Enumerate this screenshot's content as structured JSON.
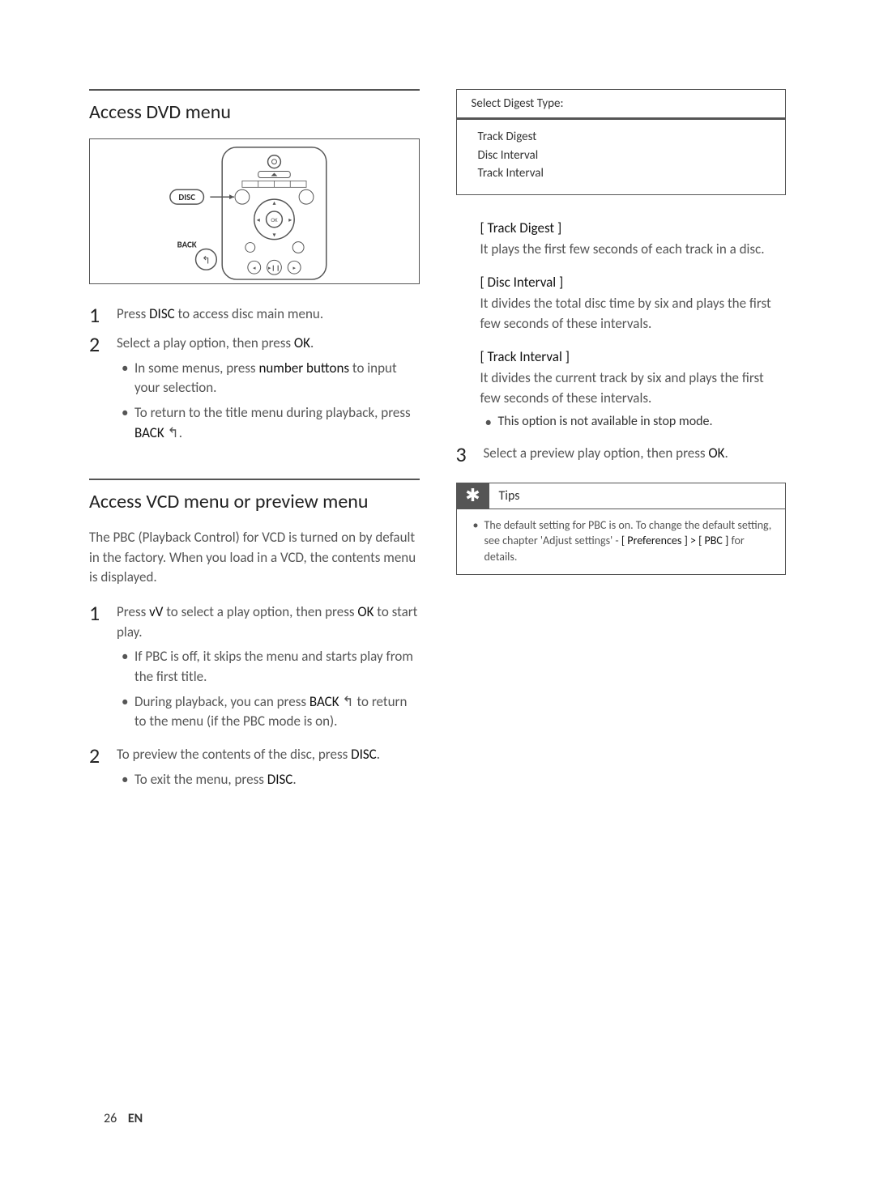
{
  "left": {
    "dvd": {
      "title": "Access DVD menu",
      "remote_labels": {
        "disc": "DISC",
        "back": "BACK",
        "ok": "OK"
      },
      "steps": [
        {
          "num": "1",
          "text_pre": "Press ",
          "bold1": "DISC",
          "text_post": " to access disc main menu."
        },
        {
          "num": "2",
          "text_pre": "Select a play option, then press ",
          "bold1": "OK",
          "text_post": ".",
          "subs": [
            {
              "pre": "In some menus, press ",
              "b": "number buttons",
              "post": " to input your selection."
            },
            {
              "pre": "To return to the title menu during playback, press ",
              "b": "BACK",
              "post": " ",
              "glyph": "↰",
              "tail": "."
            }
          ]
        }
      ]
    },
    "vcd": {
      "title": "Access VCD menu or preview menu",
      "intro": "The PBC (Playback Control) for VCD is turned on by default in the factory.  When you load in a VCD, the contents menu is displayed.",
      "steps": [
        {
          "num": "1",
          "text_pre": "Press ",
          "bold1": "vV",
          "mid": "  to select a play option, then press ",
          "bold2": "OK",
          "text_post": " to start play.",
          "subs": [
            {
              "pre": "If PBC is off, it skips the menu and starts play from the first title."
            },
            {
              "pre": "During playback, you can press ",
              "b": "BACK",
              "post": " ",
              "glyph": "↰",
              "tail": " to return to the menu (if the PBC mode is on)."
            }
          ]
        },
        {
          "num": "2",
          "text_pre": "To preview the contents of the disc, press ",
          "bold1": "DISC",
          "text_post": ".",
          "subs": [
            {
              "pre": "To exit the menu, press ",
              "b": "DISC",
              "post": "."
            }
          ]
        }
      ]
    }
  },
  "right": {
    "digest": {
      "header": "Select Digest Type:",
      "options": [
        "Track Digest",
        "Disc Interval",
        "Track Interval"
      ]
    },
    "defs": [
      {
        "title": "[ Track Digest ]",
        "desc": "It plays the first few seconds of each track in a disc."
      },
      {
        "title": "[ Disc Interval ]",
        "desc": "It divides the total disc time by six and plays the first few seconds of these intervals."
      },
      {
        "title": "[ Track Interval ]",
        "desc": "It divides the current track by six and plays the first few seconds of these intervals.",
        "sub": "This option is not available in stop mode."
      }
    ],
    "step3": {
      "num": "3",
      "text_pre": "Select a preview play option, then press ",
      "bold1": "OK",
      "text_post": "."
    },
    "tips": {
      "label": "Tips",
      "body_pre": "The default setting for PBC is on.  To change the default setting, see chapter 'Adjust settings' - ",
      "body_bold": "[ Preferences ] > [ PBC ]",
      "body_post": " for details."
    }
  },
  "footer": {
    "page": "26",
    "lang": "EN"
  }
}
